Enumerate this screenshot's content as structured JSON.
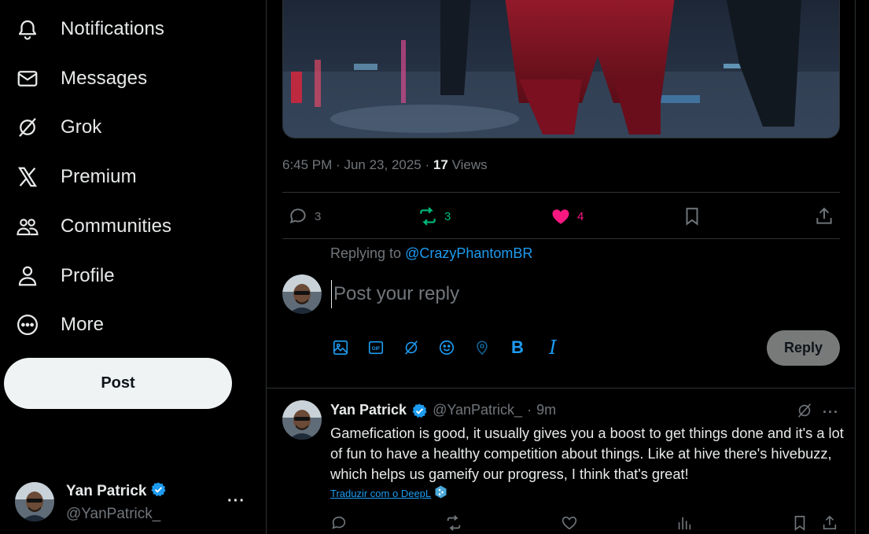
{
  "sidebar": {
    "items": [
      {
        "label": "Notifications",
        "icon": "bell-icon"
      },
      {
        "label": "Messages",
        "icon": "envelope-icon"
      },
      {
        "label": "Grok",
        "icon": "grok-icon"
      },
      {
        "label": "Premium",
        "icon": "x-logo-icon"
      },
      {
        "label": "Communities",
        "icon": "people-icon"
      },
      {
        "label": "Profile",
        "icon": "person-icon"
      },
      {
        "label": "More",
        "icon": "more-circle-icon"
      }
    ],
    "post_button": "Post",
    "account": {
      "name": "Yan Patrick",
      "handle": "@YanPatrick_",
      "more": "···"
    }
  },
  "post": {
    "time": "6:45 PM",
    "date": "Jun 23, 2025",
    "views_count": "17",
    "views_label": "Views",
    "dot": "·",
    "stats": {
      "replies": "3",
      "reposts": "3",
      "likes": "4"
    }
  },
  "composer": {
    "replying_prefix": "Replying to",
    "replying_handle": "@CrazyPhantomBR",
    "placeholder": "Post your reply",
    "reply_button": "Reply",
    "bold_label": "B",
    "italic_label": "I"
  },
  "reply_tweet": {
    "name": "Yan Patrick",
    "handle": "@YanPatrick_",
    "dot": "·",
    "time": "9m",
    "more": "···",
    "text": "Gamefication is good, it usually gives you a boost to get things done and it's a lot of fun to have a healthy competition about things. Like at hive there's hivebuzz, which helps us gameify our progress, I think that's great!",
    "translate_label": "Traduzir com o DeepL"
  },
  "colors": {
    "accent": "#1d9bf0",
    "repost": "#00ba7c",
    "like": "#f91880",
    "muted": "#71767b"
  }
}
